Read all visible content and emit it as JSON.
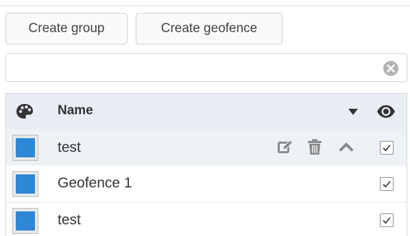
{
  "toolbar": {
    "create_group_label": "Create group",
    "create_geofence_label": "Create geofence"
  },
  "search": {
    "value": "",
    "placeholder": ""
  },
  "table": {
    "header": {
      "name_label": "Name"
    },
    "rows": [
      {
        "name": "test",
        "color": "#2e86d6",
        "visible": true,
        "selected": true
      },
      {
        "name": "Geofence 1",
        "color": "#2e86d6",
        "visible": true,
        "selected": false
      },
      {
        "name": "test",
        "color": "#2e86d6",
        "visible": true,
        "selected": false
      }
    ]
  },
  "icons": {
    "header_left": "palette-icon",
    "header_sort": "caret-down-icon",
    "header_right": "eye-icon",
    "row_actions": [
      "edit-icon",
      "trash-icon",
      "chevron-up-icon"
    ],
    "search_clear": "clear-icon"
  },
  "colors": {
    "swatch": "#2e86d6",
    "header_bg": "#eaeef4",
    "selected_row_bg": "#eef1f6"
  }
}
